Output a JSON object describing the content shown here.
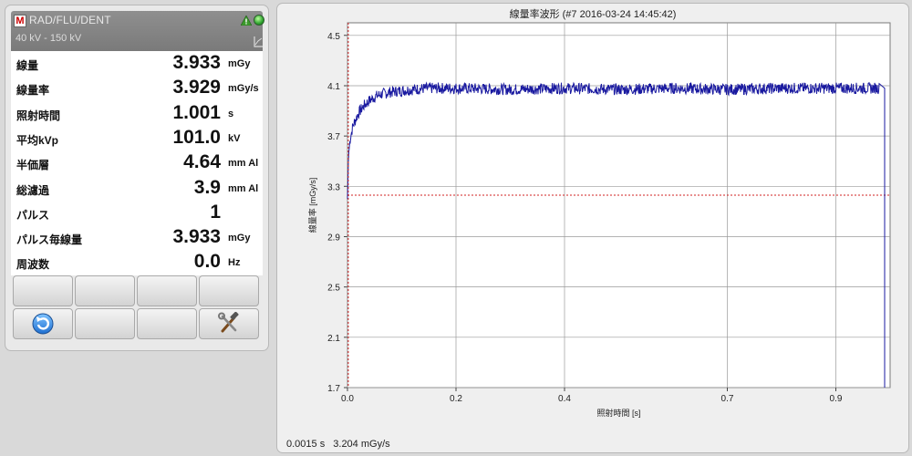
{
  "meter": {
    "mode": "RAD/FLU/DENT",
    "kv_range": "40 kV - 150 kV",
    "readings": [
      {
        "label": "線量",
        "value": "3.933",
        "unit": "mGy"
      },
      {
        "label": "線量率",
        "value": "3.929",
        "unit": "mGy/s"
      },
      {
        "label": "照射時間",
        "value": "1.001",
        "unit": "s"
      },
      {
        "label": "平均kVp",
        "value": "101.0",
        "unit": "kV"
      },
      {
        "label": "半価層",
        "value": "4.64",
        "unit": "mm Al"
      },
      {
        "label": "総濾過",
        "value": "3.9",
        "unit": "mm Al"
      },
      {
        "label": "パルス",
        "value": "1",
        "unit": ""
      },
      {
        "label": "パルス毎線量",
        "value": "3.933",
        "unit": "mGy"
      },
      {
        "label": "周波数",
        "value": "0.0",
        "unit": "Hz"
      }
    ],
    "buttons": [
      {
        "icon": ""
      },
      {
        "icon": ""
      },
      {
        "icon": ""
      },
      {
        "icon": ""
      },
      {
        "icon": "refresh-icon"
      },
      {
        "icon": ""
      },
      {
        "icon": ""
      },
      {
        "icon": "tools-icon"
      }
    ]
  },
  "chart": {
    "title": "線量率波形 (#7   2016-03-24  14:45:42)",
    "cursor_time": "0.0015 s",
    "cursor_value": "3.204 mGy/s"
  },
  "chart_data": {
    "type": "line",
    "title": "線量率波形 (#7   2016-03-24  14:45:42)",
    "xlabel": "照射時間 [s]",
    "ylabel": "線量率 [mGy/s]",
    "xlim": [
      0.0,
      1.0
    ],
    "ylim": [
      1.7,
      4.6
    ],
    "x_ticks": [
      "0.0",
      "0.2",
      "0.4",
      "0.7",
      "0.9"
    ],
    "x_tick_values": [
      0.0,
      0.2,
      0.4,
      0.7,
      0.9
    ],
    "y_ticks": [
      "1.7",
      "2.1",
      "2.5",
      "2.9",
      "3.3",
      "3.7",
      "4.1",
      "4.5"
    ],
    "y_tick_values": [
      1.7,
      2.1,
      2.5,
      2.9,
      3.3,
      3.7,
      4.1,
      4.5
    ],
    "series": [
      {
        "color": "#1a1aa0",
        "x": [
          0.0,
          0.002,
          0.005,
          0.01,
          0.02,
          0.03,
          0.04,
          0.05,
          0.06,
          0.08,
          0.1,
          0.12,
          0.15,
          0.2,
          0.3,
          0.4,
          0.5,
          0.6,
          0.7,
          0.8,
          0.9,
          0.95,
          0.98,
          0.99
        ],
        "y": [
          3.2,
          3.55,
          3.68,
          3.78,
          3.88,
          3.94,
          3.98,
          4.01,
          4.03,
          4.05,
          4.06,
          4.07,
          4.08,
          4.08,
          4.07,
          4.08,
          4.07,
          4.08,
          4.07,
          4.08,
          4.08,
          4.08,
          4.08,
          1.7
        ]
      }
    ],
    "reference_line": {
      "y": 3.23,
      "color": "#d02020"
    },
    "cursor_line": {
      "x": 0.0015,
      "color": "#d02020"
    },
    "grid": true
  }
}
